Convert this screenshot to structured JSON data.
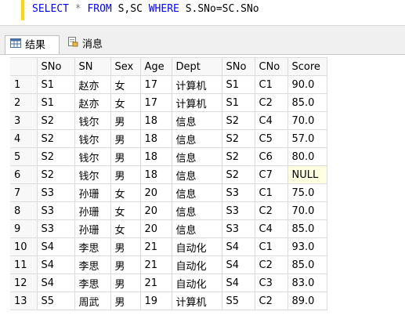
{
  "query": {
    "kw_select": "SELECT",
    "star": "*",
    "kw_from": "FROM",
    "tables": "S,SC",
    "kw_where": "WHERE",
    "condition": "S.SNo=SC.SNo"
  },
  "tabs": [
    {
      "label": "结果",
      "icon": "grid-icon"
    },
    {
      "label": "消息",
      "icon": "message-icon"
    }
  ],
  "columns": [
    "SNo",
    "SN",
    "Sex",
    "Age",
    "Dept",
    "SNo",
    "CNo",
    "Score"
  ],
  "rows": [
    [
      "1",
      "S1",
      "赵亦",
      "女",
      "17",
      "计算机",
      "S1",
      "C1",
      "90.0"
    ],
    [
      "2",
      "S1",
      "赵亦",
      "女",
      "17",
      "计算机",
      "S1",
      "C2",
      "85.0"
    ],
    [
      "3",
      "S2",
      "钱尔",
      "男",
      "18",
      "信息",
      "S2",
      "C4",
      "70.0"
    ],
    [
      "4",
      "S2",
      "钱尔",
      "男",
      "18",
      "信息",
      "S2",
      "C5",
      "57.0"
    ],
    [
      "5",
      "S2",
      "钱尔",
      "男",
      "18",
      "信息",
      "S2",
      "C6",
      "80.0"
    ],
    [
      "6",
      "S2",
      "钱尔",
      "男",
      "18",
      "信息",
      "S2",
      "C7",
      "NULL"
    ],
    [
      "7",
      "S3",
      "孙珊",
      "女",
      "20",
      "信息",
      "S3",
      "C1",
      "75.0"
    ],
    [
      "8",
      "S3",
      "孙珊",
      "女",
      "20",
      "信息",
      "S3",
      "C2",
      "70.0"
    ],
    [
      "9",
      "S3",
      "孙珊",
      "女",
      "20",
      "信息",
      "S3",
      "C4",
      "85.0"
    ],
    [
      "10",
      "S4",
      "李思",
      "男",
      "21",
      "自动化",
      "S4",
      "C1",
      "93.0"
    ],
    [
      "11",
      "S4",
      "李思",
      "男",
      "21",
      "自动化",
      "S4",
      "C2",
      "85.0"
    ],
    [
      "12",
      "S4",
      "李思",
      "男",
      "21",
      "自动化",
      "S4",
      "C3",
      "83.0"
    ],
    [
      "13",
      "S5",
      "周武",
      "男",
      "19",
      "计算机",
      "S5",
      "C2",
      "89.0"
    ]
  ],
  "colors": {
    "keyword": "#0000ff",
    "highlight": "#ffd800",
    "null_bg": "#ffffe1"
  }
}
